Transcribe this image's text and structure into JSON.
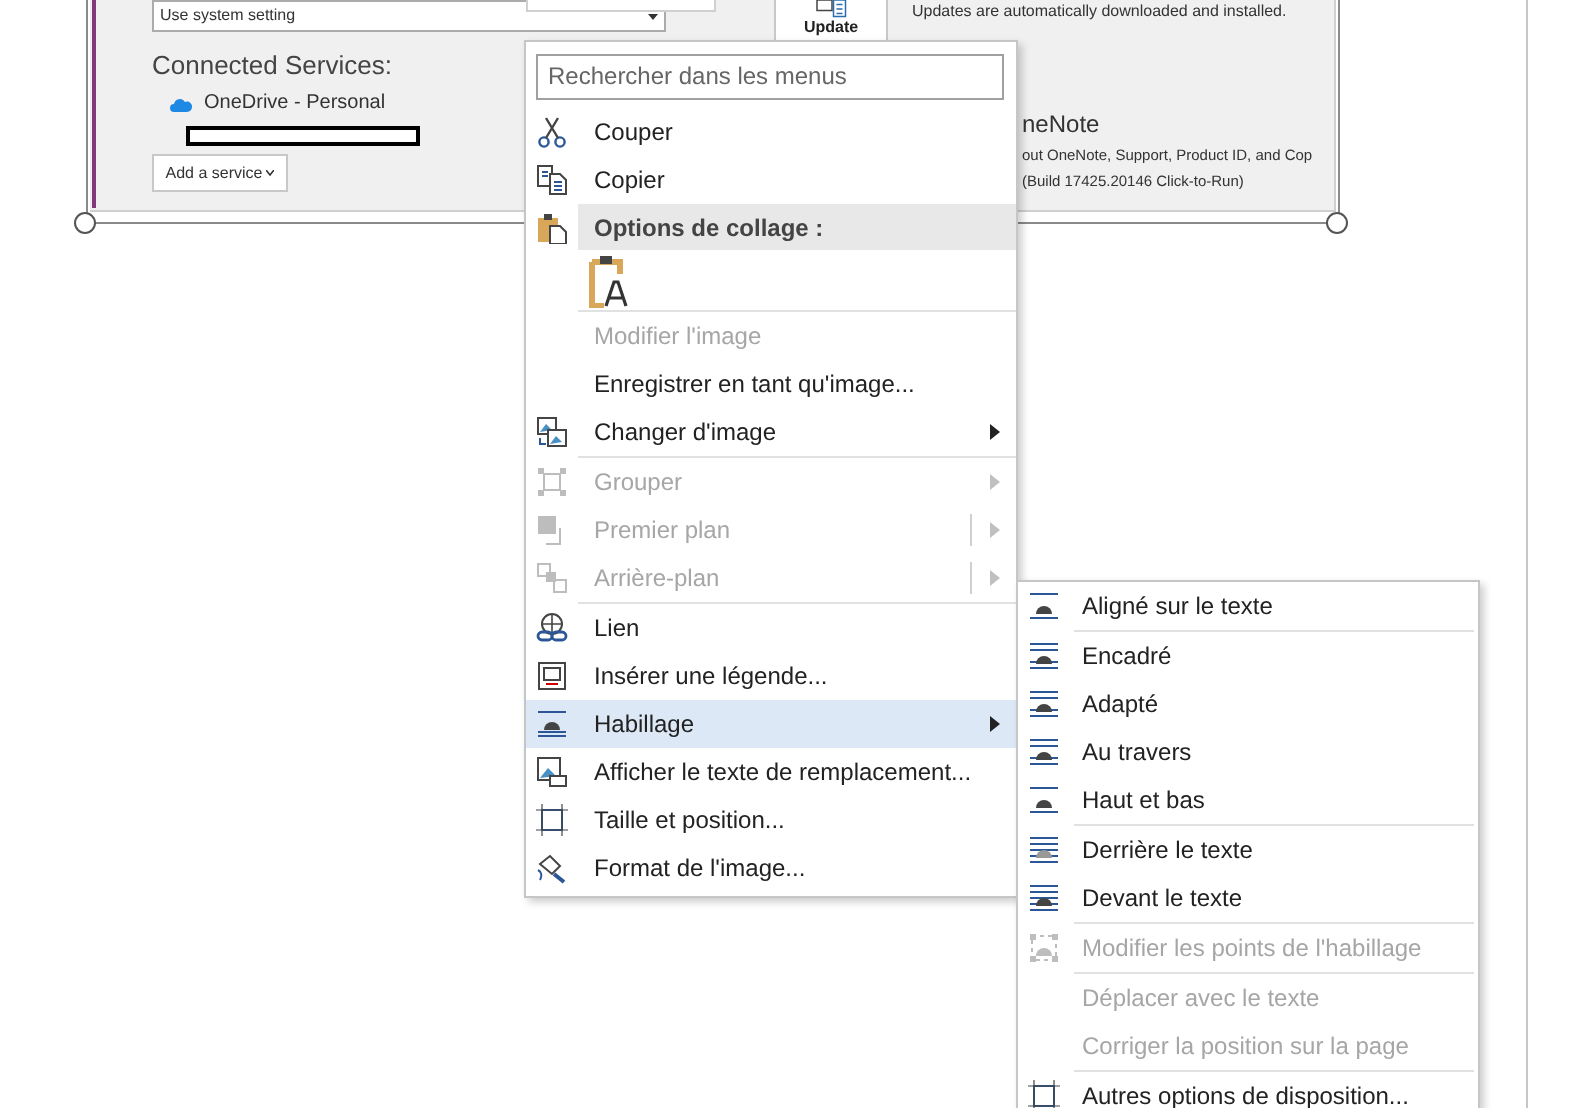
{
  "page_image": {
    "language_dropdown": "Use system setting",
    "update_button": "Update",
    "update_text": "Updates are automatically downloaded and installed.",
    "connected_services_title": "Connected Services:",
    "services": [
      "OneDrive - Personal"
    ],
    "add_service_button": "Add a service",
    "product_title": "neNote",
    "product_text": "out OneNote, Support, Product ID, and Cop",
    "build_text": "(Build 17425.20146 Click-to-Run)"
  },
  "context_menu": {
    "search_placeholder": "Rechercher dans les menus",
    "groups": [
      [
        {
          "kind": "item",
          "label": "Couper",
          "disabled": false,
          "selected": false,
          "has_submenu": false,
          "split": false
        },
        {
          "kind": "item",
          "label": "Copier",
          "disabled": false,
          "selected": false,
          "has_submenu": false,
          "split": false
        },
        {
          "kind": "header",
          "label": "Options de collage :"
        },
        {
          "kind": "paste_options"
        }
      ],
      [
        {
          "kind": "item",
          "label": "Modifier l'image",
          "disabled": true,
          "selected": false,
          "has_submenu": false,
          "split": false
        },
        {
          "kind": "item",
          "label": "Enregistrer en tant qu'image...",
          "disabled": false,
          "selected": false,
          "has_submenu": false,
          "split": false
        },
        {
          "kind": "item",
          "label": "Changer d'image",
          "disabled": false,
          "selected": false,
          "has_submenu": true,
          "split": false
        }
      ],
      [
        {
          "kind": "item",
          "label": "Grouper",
          "disabled": true,
          "selected": false,
          "has_submenu": true,
          "split": false
        },
        {
          "kind": "item",
          "label": "Premier plan",
          "disabled": true,
          "selected": false,
          "has_submenu": true,
          "split": true
        },
        {
          "kind": "item",
          "label": "Arrière-plan",
          "disabled": true,
          "selected": false,
          "has_submenu": true,
          "split": true
        }
      ],
      [
        {
          "kind": "item",
          "label": "Lien",
          "disabled": false,
          "selected": false,
          "has_submenu": false,
          "split": false
        },
        {
          "kind": "item",
          "label": "Insérer une légende...",
          "disabled": false,
          "selected": false,
          "has_submenu": false,
          "split": false
        },
        {
          "kind": "item",
          "label": "Habillage",
          "disabled": false,
          "selected": true,
          "has_submenu": true,
          "split": false
        },
        {
          "kind": "item",
          "label": "Afficher le texte de remplacement...",
          "disabled": false,
          "selected": false,
          "has_submenu": false,
          "split": false
        },
        {
          "kind": "item",
          "label": "Taille et position...",
          "disabled": false,
          "selected": false,
          "has_submenu": false,
          "split": false
        },
        {
          "kind": "item",
          "label": "Format de l'image...",
          "disabled": false,
          "selected": false,
          "has_submenu": false,
          "split": false
        }
      ]
    ]
  },
  "wrap_submenu": {
    "groups": [
      [
        {
          "label": "Aligné sur le texte",
          "disabled": false
        }
      ],
      [
        {
          "label": "Encadré",
          "disabled": false
        },
        {
          "label": "Adapté",
          "disabled": false
        },
        {
          "label": "Au travers",
          "disabled": false
        },
        {
          "label": "Haut et bas",
          "disabled": false
        }
      ],
      [
        {
          "label": "Derrière le texte",
          "disabled": false
        },
        {
          "label": "Devant le texte",
          "disabled": false
        }
      ],
      [
        {
          "label": "Modifier les points de l'habillage",
          "disabled": true
        }
      ],
      [
        {
          "label": "Déplacer avec le texte",
          "disabled": true
        },
        {
          "label": "Corriger la position sur la page",
          "disabled": true
        }
      ],
      [
        {
          "label": "Autres options de disposition...",
          "disabled": false
        }
      ]
    ]
  }
}
